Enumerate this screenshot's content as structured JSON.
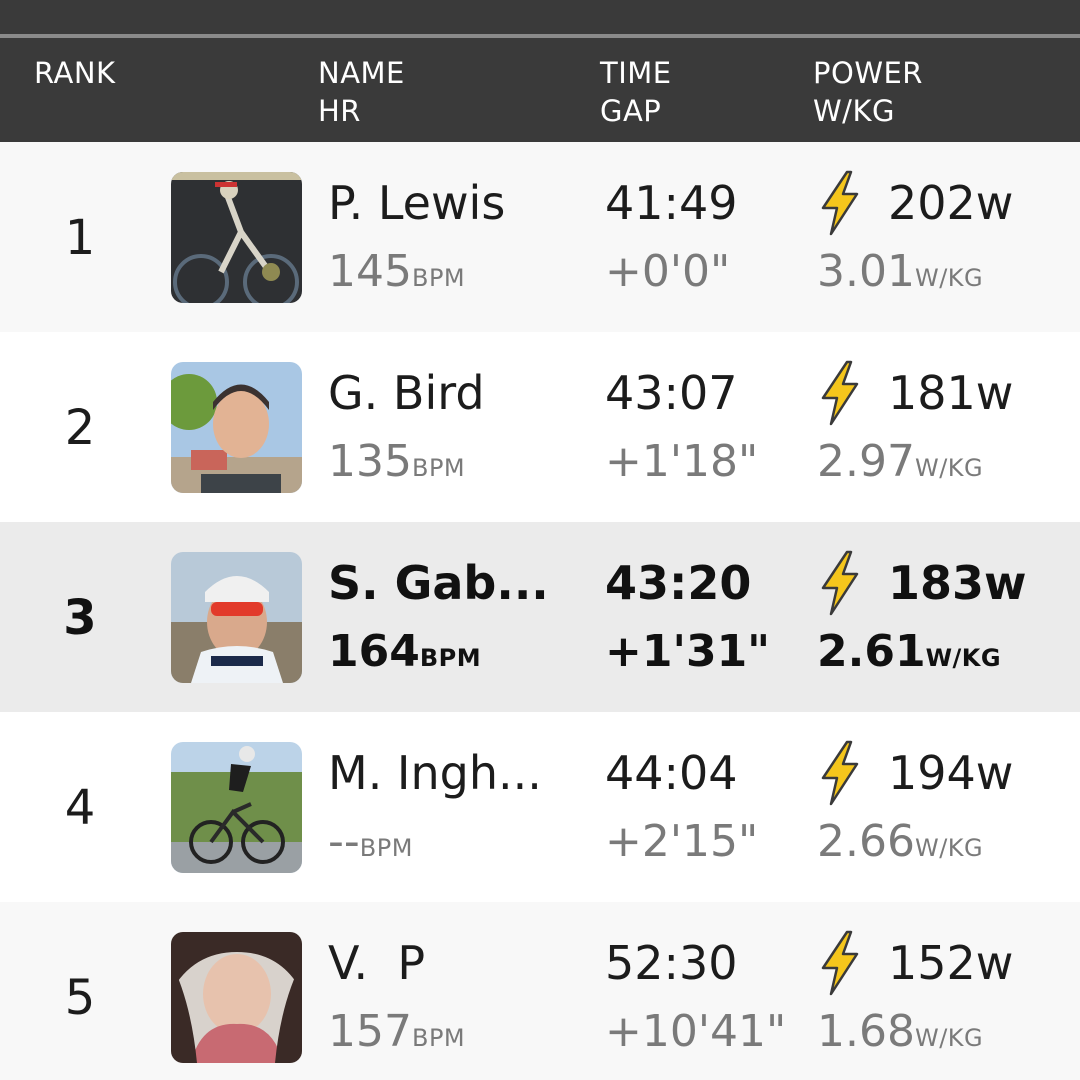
{
  "header": {
    "rank": "RANK",
    "name": "NAME",
    "hr": "HR",
    "time": "TIME",
    "gap": "GAP",
    "power": "POWER",
    "wkg": "W/KG"
  },
  "colors": {
    "header_bg": "#3a3a3a",
    "bolt": "#f5c61c",
    "highlight_row": "#ebebeb",
    "secondary_text": "#7a7a7a"
  },
  "icons": {
    "power": "lightning-bolt-icon"
  },
  "units": {
    "bpm": "BPM",
    "wkg": "W/KG"
  },
  "rows": [
    {
      "rank": "1",
      "name": "P. Lewis",
      "hr": "145",
      "time": "41:49",
      "gap": "+0'0\"",
      "power": "202w",
      "wkg": "3.01"
    },
    {
      "rank": "2",
      "name": "G. Bird",
      "hr": "135",
      "time": "43:07",
      "gap": "+1'18\"",
      "power": "181w",
      "wkg": "2.97"
    },
    {
      "rank": "3",
      "name": "S. Gab...",
      "hr": "164",
      "time": "43:20",
      "gap": "+1'31\"",
      "power": "183w",
      "wkg": "2.61",
      "highlighted": true
    },
    {
      "rank": "4",
      "name": "M. Ingh...",
      "hr": "--",
      "time": "44:04",
      "gap": "+2'15\"",
      "power": "194w",
      "wkg": "2.66"
    },
    {
      "rank": "5",
      "name": "V.  P",
      "hr": "157",
      "time": "52:30",
      "gap": "+10'41\"",
      "power": "152w",
      "wkg": "1.68"
    }
  ]
}
